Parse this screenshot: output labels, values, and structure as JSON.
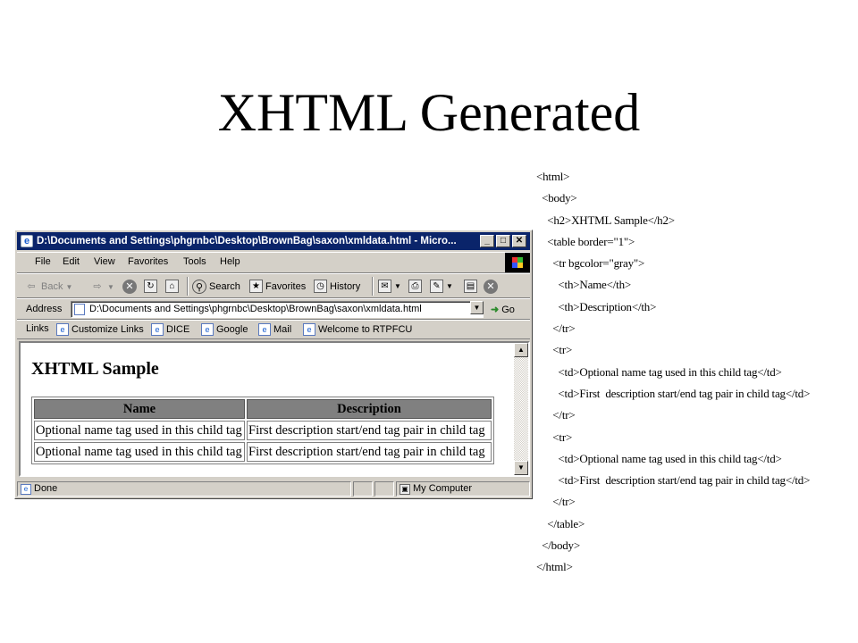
{
  "slide": {
    "title": "XHTML Generated"
  },
  "code_lines": [
    "<html>",
    "  <body>",
    "    <h2>XHTML Sample</h2>",
    "    <table border=\"1\">",
    "      <tr bgcolor=\"gray\">",
    "        <th>Name</th>",
    "        <th>Description</th>",
    "      </tr>",
    "      <tr>",
    "        <td>Optional name tag used in this child tag</td>",
    "        <td>First  description start/end tag pair in child tag</td>",
    "      </tr>",
    "      <tr>",
    "        <td>Optional name tag used in this child tag</td>",
    "        <td>First  description start/end tag pair in child tag</td>",
    "      </tr>",
    "    </table>",
    "  </body>",
    "</html>"
  ],
  "browser": {
    "title": "D:\\Documents and Settings\\phgrnbc\\Desktop\\BrownBag\\saxon\\xmldata.html - Micro...",
    "window_buttons": [
      "_",
      "□",
      "✕"
    ],
    "menu": [
      "File",
      "Edit",
      "View",
      "Favorites",
      "Tools",
      "Help"
    ],
    "toolbar": {
      "back": "Back",
      "search": "Search",
      "favorites": "Favorites",
      "history": "History"
    },
    "address": {
      "label": "Address",
      "value": "D:\\Documents and Settings\\phgrnbc\\Desktop\\BrownBag\\saxon\\xmldata.html",
      "go": "Go"
    },
    "links": {
      "label": "Links",
      "items": [
        "Customize Links",
        "DICE",
        "Google",
        "Mail",
        "Welcome to RTPFCU"
      ]
    },
    "document": {
      "heading": "XHTML Sample",
      "columns": [
        "Name",
        "Description"
      ],
      "rows": [
        [
          "Optional name tag used in this child tag",
          "First description start/end tag pair in child tag"
        ],
        [
          "Optional name tag used in this child tag",
          "First description start/end tag pair in child tag"
        ]
      ]
    },
    "status": {
      "text": "Done",
      "zone": "My Computer"
    }
  },
  "colors": {
    "titlebar": "#0a246a",
    "chrome": "#d4d0c8",
    "table_header": "#808080"
  }
}
